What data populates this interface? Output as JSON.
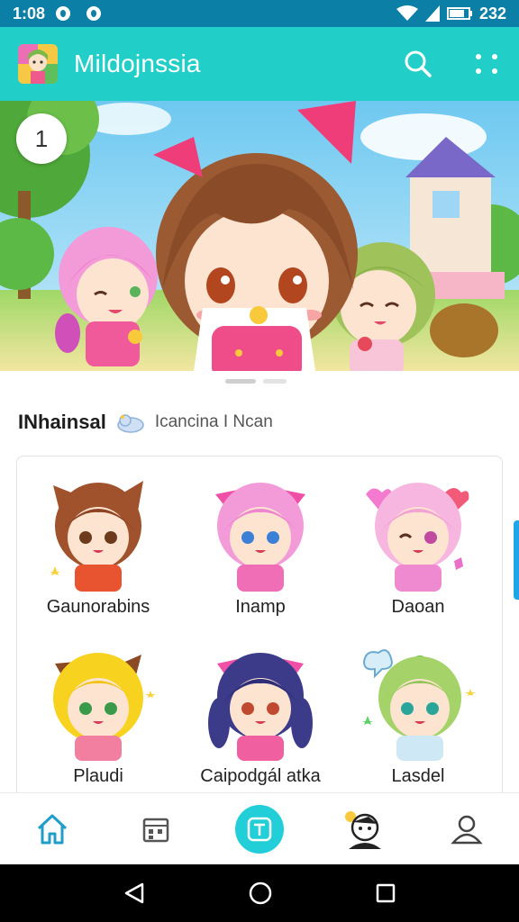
{
  "status_bar": {
    "time": "1:08",
    "battery": "232"
  },
  "app_bar": {
    "title": "Mildojnssia",
    "icons": [
      "app-logo",
      "search-icon",
      "more-vert-icon"
    ]
  },
  "banner": {
    "badge_number": "1"
  },
  "section": {
    "title": "INhainsal",
    "subtitle": "Icancina I Ncan"
  },
  "characters": [
    {
      "name": "Gaunorabins",
      "hair": "#a0522d",
      "outfit": "#e8542f"
    },
    {
      "name": "Inamp",
      "hair": "#f39bd8",
      "outfit": "#f06eb5"
    },
    {
      "name": "Daoan",
      "hair": "#f6b6e0",
      "outfit": "#f08ad0"
    },
    {
      "name": "Plaudi",
      "hair": "#f7d21f",
      "outfit": "#f27fa0"
    },
    {
      "name": "Caipodgál atka",
      "hair": "#3b3b8a",
      "outfit": "#f05fa0"
    },
    {
      "name": "Lasdel",
      "hair": "#a5d36a",
      "outfit": "#cfe8f5"
    }
  ],
  "bottom_nav": {
    "items": [
      "home-icon",
      "calendar-icon",
      "center-t-icon",
      "character-icon",
      "profile-icon"
    ]
  },
  "colors": {
    "status_bar": "#0c7fa6",
    "app_bar": "#22cfc8",
    "accent": "#22cfd8"
  }
}
